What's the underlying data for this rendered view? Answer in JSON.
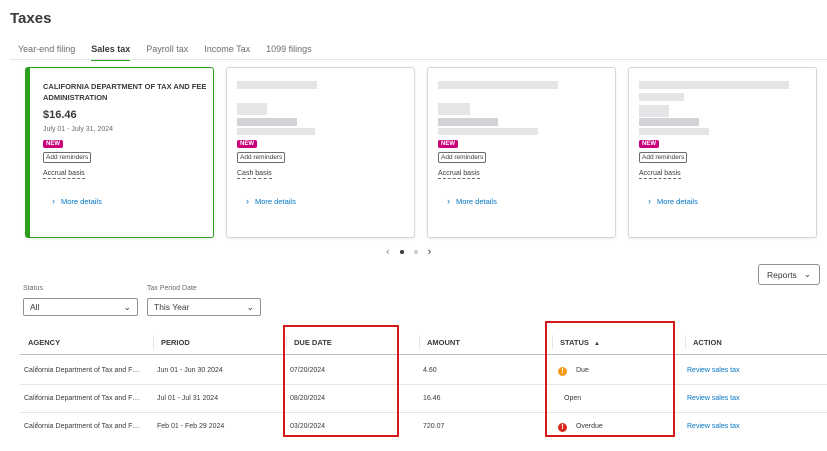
{
  "page": {
    "title": "Taxes"
  },
  "tabs": [
    {
      "label": "Year-end filing",
      "active": false
    },
    {
      "label": "Sales tax",
      "active": true
    },
    {
      "label": "Payroll tax",
      "active": false
    },
    {
      "label": "Income Tax",
      "active": false
    },
    {
      "label": "1099 filings",
      "active": false
    }
  ],
  "cards": [
    {
      "agency": "CALIFORNIA DEPARTMENT OF TAX AND FEE ADMINISTRATION",
      "amount": "$16.46",
      "period": "July 01 - July 31, 2024",
      "badge": "NEW",
      "reminder_button": "Add reminders",
      "basis": "Accrual basis",
      "more_link": "More details"
    },
    {
      "badge": "NEW",
      "reminder_button": "Add reminders",
      "basis": "Cash basis",
      "more_link": "More details"
    },
    {
      "badge": "NEW",
      "reminder_button": "Add reminders",
      "basis": "Accrual basis",
      "more_link": "More details"
    },
    {
      "badge": "NEW",
      "reminder_button": "Add reminders",
      "basis": "Accrual basis",
      "more_link": "More details"
    }
  ],
  "pager": {
    "prev": "‹",
    "next": "›",
    "pages": 2,
    "current": 1
  },
  "reports_button": "Reports",
  "filters": {
    "status_label": "Status",
    "status_value": "All",
    "period_label": "Tax Period Date",
    "period_value": "This Year"
  },
  "table": {
    "columns": [
      "AGENCY",
      "PERIOD",
      "DUE DATE",
      "AMOUNT",
      "STATUS",
      "ACTION"
    ],
    "sort_indicator": "▲",
    "rows": [
      {
        "agency": "California Department of Tax and F…",
        "period": "Jun 01 - Jun 30 2024",
        "due_date": "07/20/2024",
        "amount": "4.60",
        "status": "Due",
        "status_icon": "!",
        "action": "Review sales tax"
      },
      {
        "agency": "California Department of Tax and F…",
        "period": "Jul 01 - Jul 31 2024",
        "due_date": "08/20/2024",
        "amount": "16.46",
        "status": "Open",
        "status_icon": "",
        "action": "Review sales tax"
      },
      {
        "agency": "California Department of Tax and F…",
        "period": "Feb 01 - Feb 29 2024",
        "due_date": "03/20/2024",
        "amount": "720.07",
        "status": "Overdue",
        "status_icon": "!",
        "action": "Review sales tax"
      }
    ]
  },
  "colors": {
    "accent": "#2ca01c",
    "link": "#0077c5",
    "highlight": "#d8171a",
    "due": "#f49c19",
    "overdue": "#d52b1e",
    "new_badge": "#c9007a"
  }
}
